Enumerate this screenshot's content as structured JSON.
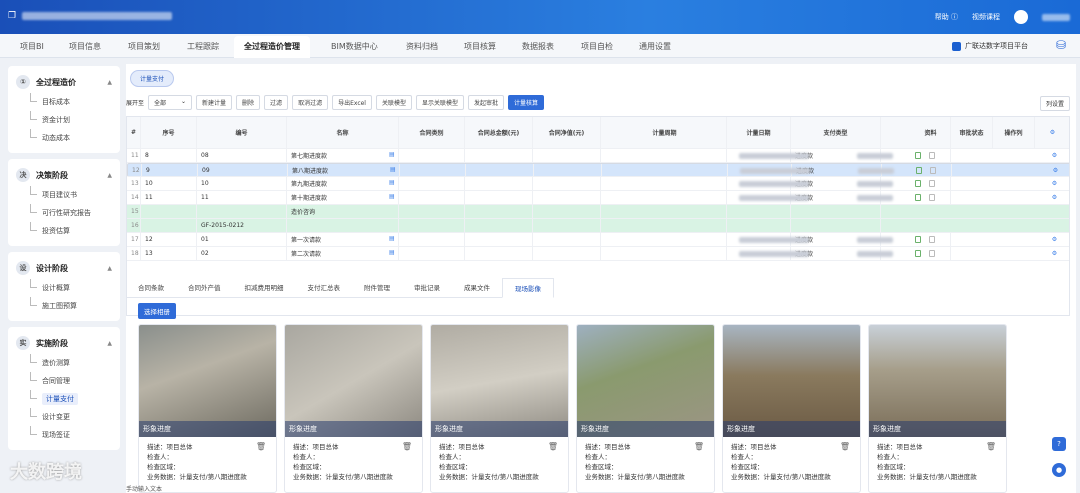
{
  "topbar": {
    "right": [
      "帮助 ⓘ",
      "视频课程"
    ]
  },
  "tabs": [
    "项目BI",
    "项目信息",
    "项目策划",
    "工程跟踪",
    "全过程造价管理",
    "BIM数据中心",
    "资料归档",
    "项目核算",
    "数据报表",
    "项目自检",
    "通用设置"
  ],
  "platform": "广联达数字项目平台",
  "sidebar": [
    {
      "title": "全过程造价",
      "icon": "①",
      "items": [
        "目标成本",
        "资金计划",
        "动态成本"
      ]
    },
    {
      "title": "决策阶段",
      "icon": "决",
      "items": [
        "项目建议书",
        "可行性研究报告",
        "投资估算"
      ]
    },
    {
      "title": "设计阶段",
      "icon": "设",
      "items": [
        "设计概算",
        "施工图预算"
      ]
    },
    {
      "title": "实施阶段",
      "icon": "实",
      "items": [
        "造价测算",
        "合同管理",
        "计量支付",
        "设计变更",
        "现场签证"
      ]
    }
  ],
  "active_item": "计量支付",
  "page_tab": "计量支付",
  "toolbar": {
    "expand": "展开至",
    "sel": "全部",
    "buttons": [
      "新建计量",
      "删除",
      "过滤",
      "取消过滤",
      "导出Excel",
      "关联模型",
      "显示关联模型",
      "发起审批"
    ],
    "primary": "计量核算",
    "colset": "列设置"
  },
  "grid": {
    "headers": [
      "#",
      "序号",
      "编号",
      "名称",
      "合同类别",
      "合同总金额(元)",
      "合同净值(元)",
      "计量周期",
      "计量日期",
      "支付类型",
      "资料",
      "审批状态",
      "操作列"
    ],
    "rows": [
      {
        "n": "11",
        "s": "8",
        "code": "08",
        "name": "第七期进度款",
        "type": "进度款",
        "style": ""
      },
      {
        "n": "12",
        "s": "9",
        "code": "09",
        "name": "第八期进度款",
        "type": "进度款",
        "style": "sel"
      },
      {
        "n": "13",
        "s": "10",
        "code": "10",
        "name": "第九期进度款",
        "type": "进度款",
        "style": ""
      },
      {
        "n": "14",
        "s": "11",
        "code": "11",
        "name": "第十期进度款",
        "type": "进度款",
        "style": ""
      },
      {
        "n": "15",
        "s": "",
        "code": "",
        "name": "造价咨询",
        "type": "",
        "style": "green"
      },
      {
        "n": "16",
        "s": "",
        "code": "GF-2015-0212",
        "name": "",
        "type": "",
        "style": "green"
      },
      {
        "n": "17",
        "s": "12",
        "code": "01",
        "name": "第一次请款",
        "type": "进度款",
        "style": ""
      },
      {
        "n": "18",
        "s": "13",
        "code": "02",
        "name": "第二次请款",
        "type": "进度款",
        "style": ""
      }
    ]
  },
  "subtabs": [
    "合同条款",
    "合同外产值",
    "扣减费用明细",
    "支付汇总表",
    "附件管理",
    "审批记录",
    "成果文件",
    "现场影像"
  ],
  "select_btn": "选择相册",
  "card_label": "形象进度",
  "card_desc": "描述：项目总体",
  "card_inspector": "检查人：",
  "card_area": "检查区域：",
  "card_biz": "业务数据：计量支付/第八期进度款",
  "footer": "手动输入文本",
  "watermark": "大数跨境",
  "colors": {
    "primary": "#2f6bd8",
    "topbar": "#1a4fb8"
  }
}
